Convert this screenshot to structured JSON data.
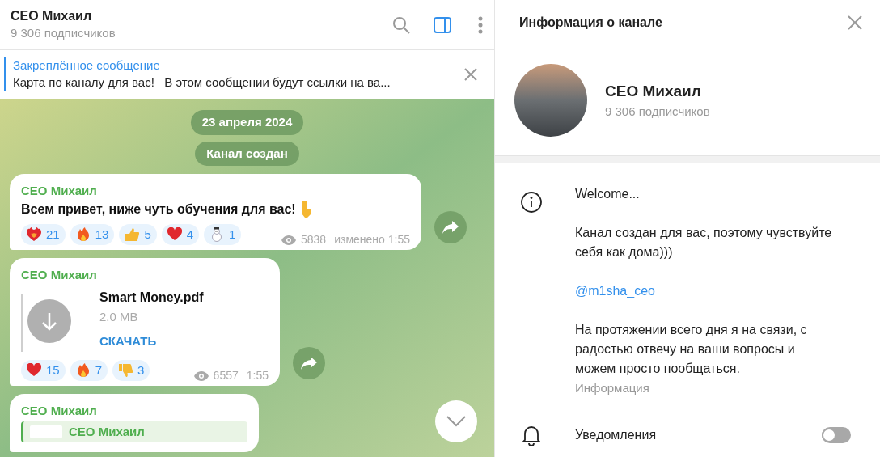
{
  "chat_header": {
    "title": "СЕО Михаил",
    "subtitle": "9 306 подписчиков",
    "info_panel_open": true
  },
  "pinned": {
    "label": "Закреплённое сообщение",
    "text": "Карта по каналу для вас!   В этом сообщении будут ссылки на ва..."
  },
  "service_messages": [
    "23 апреля 2024",
    "Канал создан"
  ],
  "messages": [
    {
      "kind": "text",
      "author": "СЕО Михаил",
      "text": "Всем привет, ниже чуть обучения для вас!",
      "reactions": [
        {
          "kind": "heart_fire",
          "count": "21"
        },
        {
          "kind": "fire",
          "count": "13"
        },
        {
          "kind": "thumbs_up",
          "count": "5"
        },
        {
          "kind": "heart",
          "count": "4"
        },
        {
          "kind": "snowman",
          "count": "1"
        }
      ],
      "views": "5838",
      "time": "изменено 1:55"
    },
    {
      "kind": "file",
      "author": "СЕО Михаил",
      "file_name": "Smart Money.pdf",
      "file_size": "2.0 MB",
      "action": "СКАЧАТЬ",
      "reactions": [
        {
          "kind": "heart",
          "count": "15"
        },
        {
          "kind": "fire",
          "count": "7"
        },
        {
          "kind": "thumbs_down",
          "count": "3"
        }
      ],
      "views": "6557",
      "time": "1:55"
    },
    {
      "kind": "reply",
      "author": "СЕО Михаил",
      "reply_author": "СЕО Михаил"
    }
  ],
  "info_panel": {
    "title": "Информация о канале",
    "name": "СЕО Михаил",
    "subtitle": "9 306 подписчиков",
    "description": [
      {
        "kind": "text",
        "text": "Welcome..."
      },
      {
        "kind": "text",
        "text": "Канал создан для вас, поэтому чувствуйте себя как дома)))"
      },
      {
        "kind": "link",
        "text": "@m1sha_ceo"
      },
      {
        "kind": "text",
        "text": "На протяжении всего дня я на связи, с радостью отвечу на ваши вопросы и можем просто пообщаться."
      }
    ],
    "description_label": "Информация",
    "notifications": {
      "label": "Уведомления",
      "on": false
    }
  }
}
